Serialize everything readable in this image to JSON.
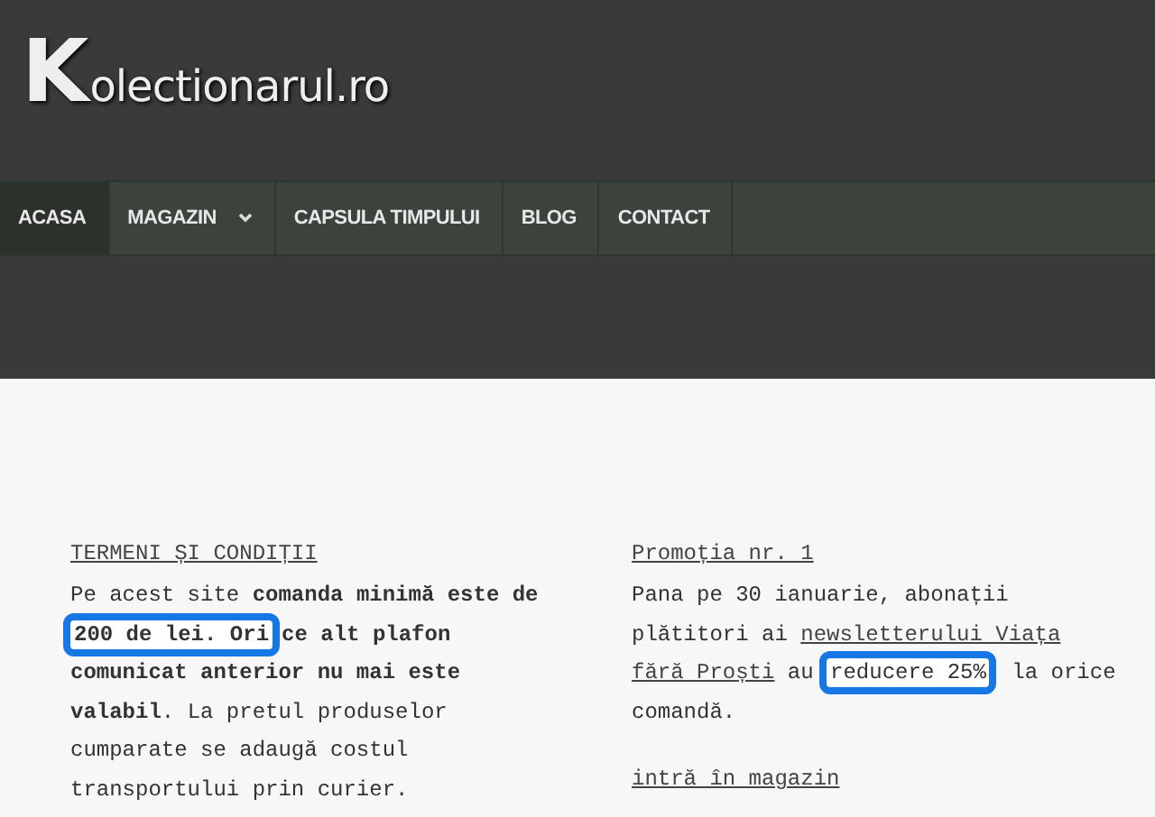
{
  "logo": {
    "initial": "K",
    "rest": "olectionarul.ro"
  },
  "nav": [
    {
      "label": "ACASA",
      "selected": true,
      "dropdown": false
    },
    {
      "label": "MAGAZIN",
      "selected": false,
      "dropdown": true
    },
    {
      "label": "CAPSULA TIMPULUI",
      "selected": false,
      "dropdown": false
    },
    {
      "label": "BLOG",
      "selected": false,
      "dropdown": false
    },
    {
      "label": "CONTACT",
      "selected": false,
      "dropdown": false
    }
  ],
  "columns": [
    {
      "heading": "TERMENI ȘI CONDIȚII",
      "paragraph": [
        {
          "kind": "text",
          "text": "Pe acest site ",
          "bold": false,
          "highlighted": false
        },
        {
          "kind": "text",
          "text": "comanda minimă este de ",
          "bold": true,
          "highlighted": false
        },
        {
          "kind": "text",
          "text": "200 de lei. Ori",
          "bold": true,
          "highlighted": true
        },
        {
          "kind": "text",
          "text": "ce alt plafon comunicat anterior nu mai este valabil",
          "bold": true,
          "highlighted": false
        },
        {
          "kind": "text",
          "text": ". La pretul produselor cumparate se adaugă costul transportului prin curier.",
          "bold": false,
          "highlighted": false
        }
      ]
    },
    {
      "heading": "Promoția nr. 1",
      "paragraph": [
        {
          "kind": "text",
          "text": "Pana pe 30 ianuarie, abonații plătitori ai ",
          "bold": false,
          "highlighted": false
        },
        {
          "kind": "link",
          "text": "newsletterului Viața "
        },
        {
          "kind": "link",
          "text": "fără Proști"
        },
        {
          "kind": "text",
          "text": " au ",
          "bold": false,
          "highlighted": false
        },
        {
          "kind": "text",
          "text": "reducere 25%",
          "bold": false,
          "highlighted": true
        },
        {
          "kind": "text",
          "text": " la orice comandă.",
          "bold": false,
          "highlighted": false
        }
      ],
      "link": "intră în magazin"
    }
  ]
}
